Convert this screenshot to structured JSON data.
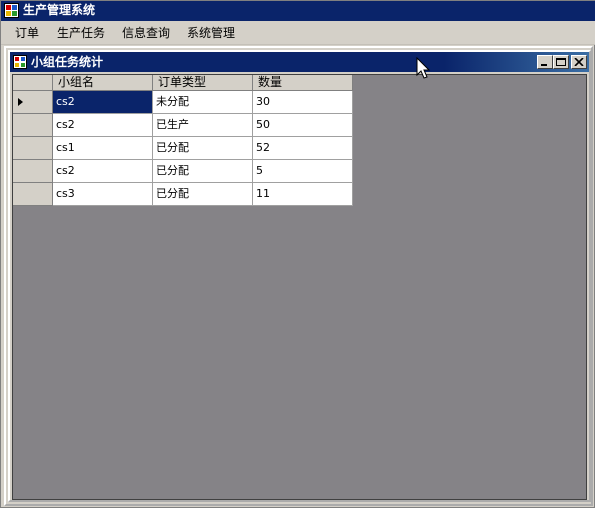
{
  "app": {
    "title": "生产管理系统"
  },
  "menu": {
    "items": [
      {
        "label": "订单"
      },
      {
        "label": "生产任务"
      },
      {
        "label": "信息查询"
      },
      {
        "label": "系统管理"
      }
    ]
  },
  "child_window": {
    "title": "小组任务统计",
    "buttons": [
      {
        "icon": "minimize-icon"
      },
      {
        "icon": "maximize-icon"
      },
      {
        "icon": "close-icon"
      }
    ]
  },
  "table": {
    "columns": [
      "小组名",
      "订单类型",
      "数量"
    ],
    "rows": [
      {
        "group": "cs2",
        "type": "未分配",
        "qty": "30",
        "current": true
      },
      {
        "group": "cs2",
        "type": "已生产",
        "qty": "50",
        "current": false
      },
      {
        "group": "cs1",
        "type": "已分配",
        "qty": "52",
        "current": false
      },
      {
        "group": "cs2",
        "type": "已分配",
        "qty": "5",
        "current": false
      },
      {
        "group": "cs3",
        "type": "已分配",
        "qty": "11",
        "current": false
      }
    ]
  },
  "colors": {
    "titlebar": "#0a246a",
    "workspace": "#858387",
    "selection": "#0a246a"
  }
}
